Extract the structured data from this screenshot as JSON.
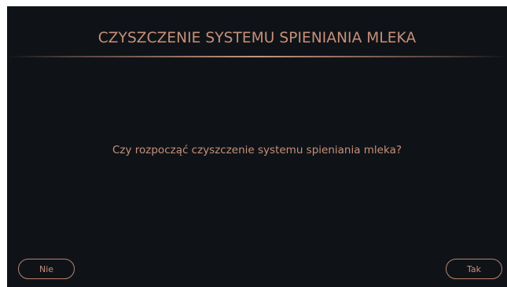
{
  "dialog": {
    "title": "CZYSZCZENIE SYSTEMU SPIENIANIA MLEKA",
    "question": "Czy rozpocząć czyszczenie systemu spieniania mleka?"
  },
  "buttons": {
    "no_label": "Nie",
    "yes_label": "Tak"
  },
  "colors": {
    "background": "#0f1318",
    "accent": "#c79079"
  }
}
